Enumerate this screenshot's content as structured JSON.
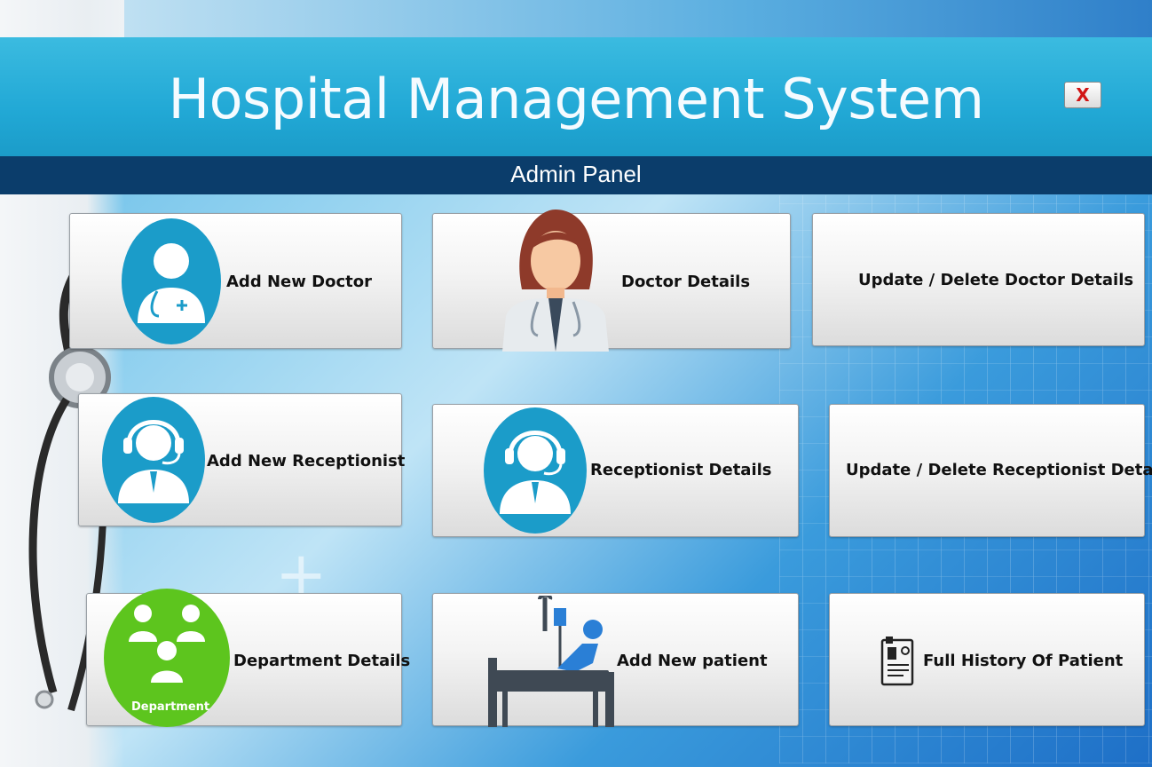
{
  "header": {
    "title": "Hospital Management System",
    "subtitle": "Admin Panel",
    "close_label": "X"
  },
  "tiles": {
    "add_doctor": "Add New Doctor",
    "doctor_details": "Doctor Details",
    "update_doctor": "Update / Delete Doctor Details",
    "add_receptionist": "Add New Receptionist",
    "receptionist_details": "Receptionist Details",
    "update_receptionist": "Update / Delete Receptionist Details",
    "department_details": "Department Details",
    "department_icon_text": "Department",
    "add_patient": "Add New patient",
    "patient_history": "Full History Of Patient"
  },
  "icons": {
    "doctor": "doctor-icon",
    "female_doctor": "female-doctor-icon",
    "receptionist": "receptionist-headset-icon",
    "department": "department-group-icon",
    "patient": "hospital-bed-icon",
    "history": "medical-record-icon"
  },
  "colors": {
    "header_cyan": "#22a9d6",
    "subbar_navy": "#0b3d6b",
    "icon_blue": "#1b9cc9",
    "department_green": "#5dc51e",
    "close_red": "#d11414"
  }
}
